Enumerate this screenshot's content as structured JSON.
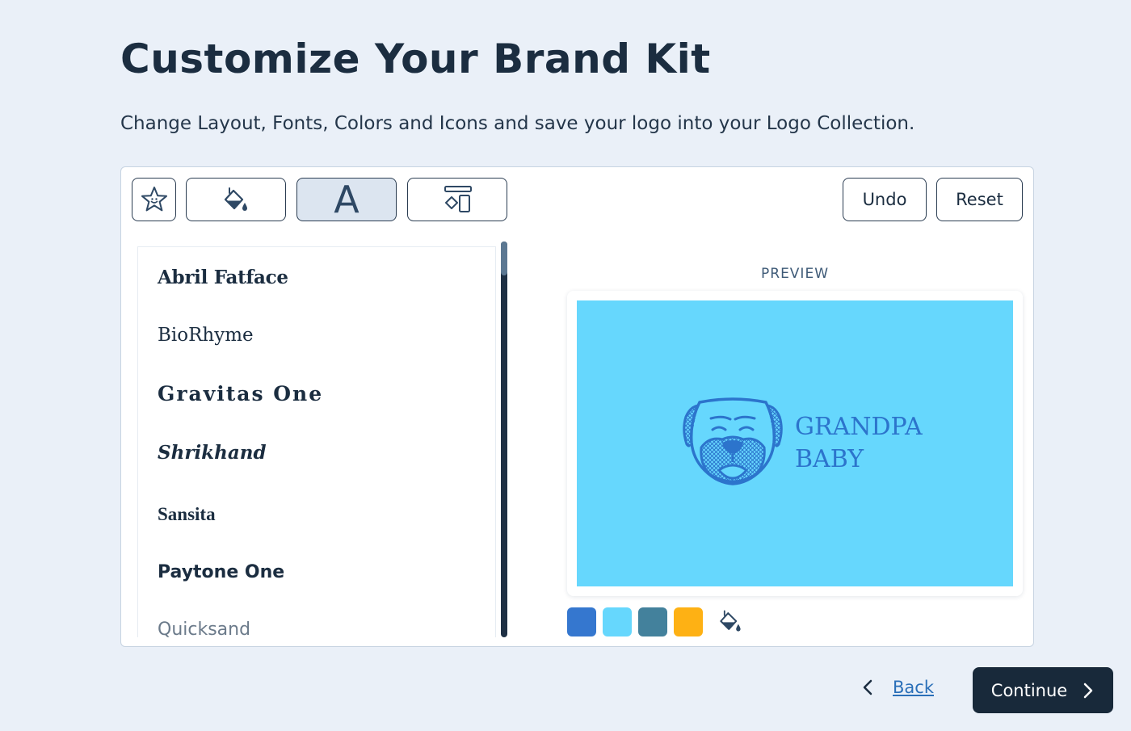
{
  "page": {
    "title": "Customize Your Brand Kit",
    "subtitle": "Change Layout, Fonts, Colors and Icons and save your logo into your Logo Collection."
  },
  "toolbar": {
    "tools": [
      {
        "icon": "star-icon"
      },
      {
        "icon": "paint-bucket-icon"
      },
      {
        "icon": "font-icon",
        "glyph": "A",
        "active": true
      },
      {
        "icon": "layout-icon"
      }
    ],
    "undo_label": "Undo",
    "reset_label": "Reset"
  },
  "fonts": {
    "items": [
      "Abril Fatface",
      "BioRhyme",
      "Gravitas One",
      "Shrikhand",
      "Sansita",
      "Paytone One",
      "Quicksand"
    ]
  },
  "preview": {
    "label": "PREVIEW",
    "background_color": "#66D7FD",
    "logo_color": "#2C74CC",
    "logo_icon": "dog-face-icon",
    "brand_line1": "GRANDPA",
    "brand_line2": "BABY"
  },
  "palette": {
    "colors": [
      "#3577CF",
      "#66D7FD",
      "#43819C",
      "#FEB114"
    ],
    "edit_icon": "paint-bucket-icon"
  },
  "footer": {
    "back_label": "Back",
    "continue_label": "Continue"
  }
}
